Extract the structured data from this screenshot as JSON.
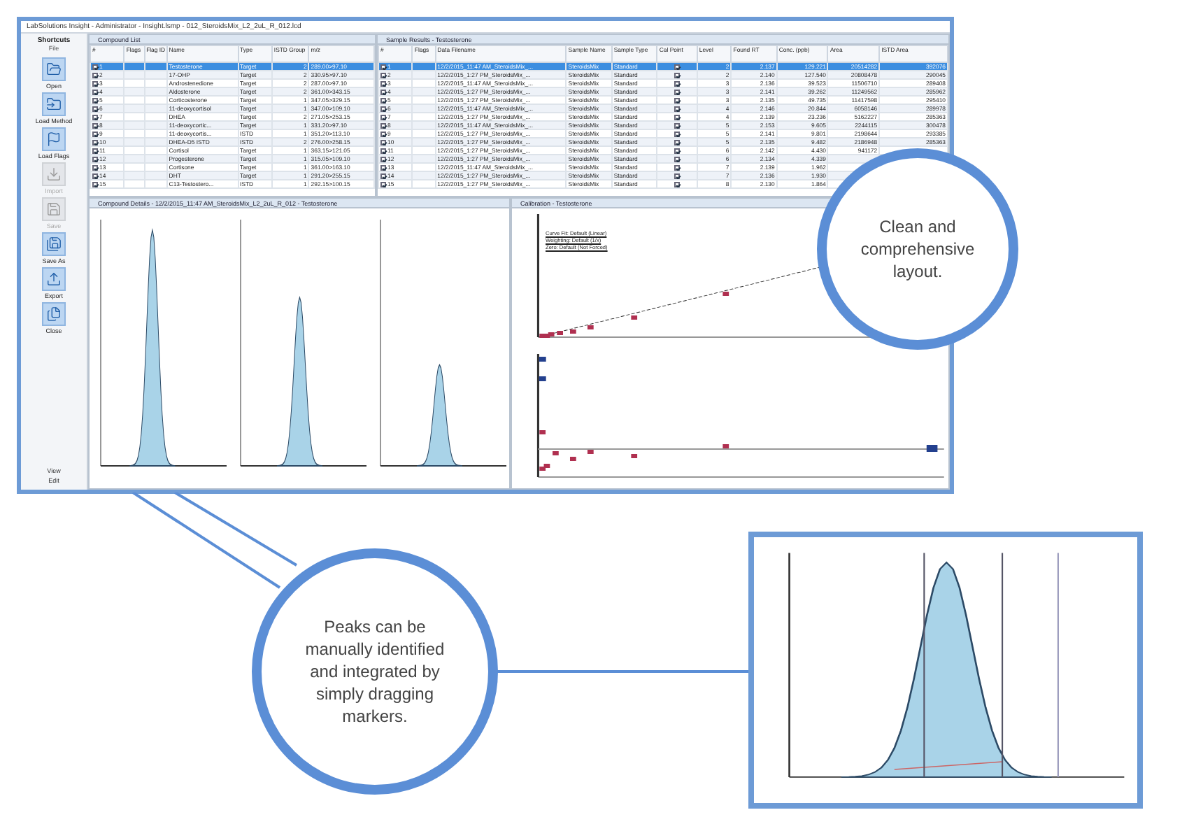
{
  "window": {
    "title": "LabSolutions Insight - Administrator - Insight.lsmp - 012_SteroidsMix_L2_2uL_R_012.lcd"
  },
  "sidebar": {
    "title": "Shortcuts",
    "section": "File",
    "items": [
      {
        "label": "Open",
        "kind": "open",
        "disabled": false
      },
      {
        "label": "Load Method",
        "kind": "method",
        "disabled": false
      },
      {
        "label": "Load Flags",
        "kind": "flags",
        "disabled": false
      },
      {
        "label": "Import",
        "kind": "import",
        "disabled": true
      },
      {
        "label": "Save",
        "kind": "save",
        "disabled": true
      },
      {
        "label": "Save As",
        "kind": "saveas",
        "disabled": false
      },
      {
        "label": "Export",
        "kind": "export",
        "disabled": false
      },
      {
        "label": "Close",
        "kind": "close",
        "disabled": false
      }
    ],
    "footer": [
      "View",
      "Edit"
    ]
  },
  "compound_list": {
    "title": "Compound List",
    "columns": [
      "#",
      "Flags",
      "Flag ID",
      "Name",
      "Type",
      "ISTD Group",
      "m/z"
    ],
    "rows": [
      {
        "n": "1",
        "name": "Testosterone",
        "type": "Target",
        "istd": "2",
        "mz": "289.00>97.10",
        "checked": true,
        "selected": true
      },
      {
        "n": "2",
        "name": "17-OHP",
        "type": "Target",
        "istd": "2",
        "mz": "330.95>97.10",
        "checked": true,
        "selected": false
      },
      {
        "n": "3",
        "name": "Androstenedione",
        "type": "Target",
        "istd": "2",
        "mz": "287.00>97.10",
        "checked": true,
        "selected": false
      },
      {
        "n": "4",
        "name": "Aldosterone",
        "type": "Target",
        "istd": "2",
        "mz": "361.00>343.15",
        "checked": true,
        "selected": false
      },
      {
        "n": "5",
        "name": "Corticosterone",
        "type": "Target",
        "istd": "1",
        "mz": "347.05>329.15",
        "checked": true,
        "selected": false
      },
      {
        "n": "6",
        "name": "11-deoxycortisol",
        "type": "Target",
        "istd": "1",
        "mz": "347.00>109.10",
        "checked": true,
        "selected": false
      },
      {
        "n": "7",
        "name": "DHEA",
        "type": "Target",
        "istd": "2",
        "mz": "271.05>253.15",
        "checked": true,
        "selected": false
      },
      {
        "n": "8",
        "name": "11-deoxycortic...",
        "type": "Target",
        "istd": "1",
        "mz": "331.20>97.10",
        "checked": true,
        "selected": false
      },
      {
        "n": "9",
        "name": "11-deoxycortis...",
        "type": "ISTD",
        "istd": "1",
        "mz": "351.20>113.10",
        "checked": true,
        "selected": false
      },
      {
        "n": "10",
        "name": "DHEA-D5 ISTD",
        "type": "ISTD",
        "istd": "2",
        "mz": "276.00>258.15",
        "checked": true,
        "selected": false
      },
      {
        "n": "11",
        "name": "Cortisol",
        "type": "Target",
        "istd": "1",
        "mz": "363.15>121.05",
        "checked": true,
        "selected": false
      },
      {
        "n": "12",
        "name": "Progesterone",
        "type": "Target",
        "istd": "1",
        "mz": "315.05>109.10",
        "checked": true,
        "selected": false
      },
      {
        "n": "13",
        "name": "Cortisone",
        "type": "Target",
        "istd": "1",
        "mz": "361.00>163.10",
        "checked": true,
        "selected": false
      },
      {
        "n": "14",
        "name": "DHT",
        "type": "Target",
        "istd": "1",
        "mz": "291.20>255.15",
        "checked": true,
        "selected": false
      },
      {
        "n": "15",
        "name": "C13-Testostero...",
        "type": "ISTD",
        "istd": "1",
        "mz": "292.15>100.15",
        "checked": true,
        "selected": false
      }
    ]
  },
  "sample_results": {
    "title": "Sample Results - Testosterone",
    "columns": [
      "#",
      "Flags",
      "Data Filename",
      "Sample Name",
      "Sample Type",
      "Cal Point",
      "Level",
      "Found RT",
      "Conc. (ppb)",
      "Area",
      "ISTD Area"
    ],
    "rows": [
      {
        "n": "1",
        "file": "12/2/2015_11:47 AM_SteroidsMix_...",
        "name": "SteroidsMix",
        "type": "Standard",
        "level": "2",
        "rt": "2.137",
        "conc": "129.221",
        "area": "20514282",
        "istd": "392076",
        "checked": true,
        "cal": true,
        "selected": true
      },
      {
        "n": "2",
        "file": "12/2/2015_1:27 PM_SteroidsMix_...",
        "name": "SteroidsMix",
        "type": "Standard",
        "level": "2",
        "rt": "2.140",
        "conc": "127.540",
        "area": "20808478",
        "istd": "290045",
        "checked": true,
        "cal": true,
        "selected": false
      },
      {
        "n": "3",
        "file": "12/2/2015_11:47 AM_SteroidsMix_...",
        "name": "SteroidsMix",
        "type": "Standard",
        "level": "3",
        "rt": "2.136",
        "conc": "39.523",
        "area": "11506710",
        "istd": "289408",
        "checked": true,
        "cal": true,
        "selected": false
      },
      {
        "n": "4",
        "file": "12/2/2015_1:27 PM_SteroidsMix_...",
        "name": "SteroidsMix",
        "type": "Standard",
        "level": "3",
        "rt": "2.141",
        "conc": "39.262",
        "area": "11249562",
        "istd": "285962",
        "checked": true,
        "cal": true,
        "selected": false
      },
      {
        "n": "5",
        "file": "12/2/2015_1:27 PM_SteroidsMix_...",
        "name": "SteroidsMix",
        "type": "Standard",
        "level": "3",
        "rt": "2.135",
        "conc": "49.735",
        "area": "11417598",
        "istd": "295410",
        "checked": true,
        "cal": true,
        "selected": false
      },
      {
        "n": "6",
        "file": "12/2/2015_11:47 AM_SteroidsMix_...",
        "name": "SteroidsMix",
        "type": "Standard",
        "level": "4",
        "rt": "2.146",
        "conc": "20.844",
        "area": "6058146",
        "istd": "289978",
        "checked": true,
        "cal": true,
        "selected": false
      },
      {
        "n": "7",
        "file": "12/2/2015_1:27 PM_SteroidsMix_...",
        "name": "SteroidsMix",
        "type": "Standard",
        "level": "4",
        "rt": "2.139",
        "conc": "23.236",
        "area": "5162227",
        "istd": "285363",
        "checked": true,
        "cal": true,
        "selected": false
      },
      {
        "n": "8",
        "file": "12/2/2015_11:47 AM_SteroidsMix_...",
        "name": "SteroidsMix",
        "type": "Standard",
        "level": "5",
        "rt": "2.153",
        "conc": "9.605",
        "area": "2244115",
        "istd": "300478",
        "checked": true,
        "cal": true,
        "selected": false
      },
      {
        "n": "9",
        "file": "12/2/2015_1:27 PM_SteroidsMix_...",
        "name": "SteroidsMix",
        "type": "Standard",
        "level": "5",
        "rt": "2.141",
        "conc": "9.801",
        "area": "2198644",
        "istd": "293385",
        "checked": true,
        "cal": true,
        "selected": false
      },
      {
        "n": "10",
        "file": "12/2/2015_1:27 PM_SteroidsMix_...",
        "name": "SteroidsMix",
        "type": "Standard",
        "level": "5",
        "rt": "2.135",
        "conc": "9.482",
        "area": "2186948",
        "istd": "285363",
        "checked": true,
        "cal": true,
        "selected": false
      },
      {
        "n": "11",
        "file": "12/2/2015_1:27 PM_SteroidsMix_...",
        "name": "SteroidsMix",
        "type": "Standard",
        "level": "6",
        "rt": "2.142",
        "conc": "4.430",
        "area": "941172",
        "checked": true,
        "cal": true,
        "selected": false
      },
      {
        "n": "12",
        "file": "12/2/2015_1:27 PM_SteroidsMix_...",
        "name": "SteroidsMix",
        "type": "Standard",
        "level": "6",
        "rt": "2.134",
        "conc": "4.339",
        "checked": true,
        "cal": true,
        "selected": false
      },
      {
        "n": "13",
        "file": "12/2/2015_11:47 AM_SteroidsMix_...",
        "name": "SteroidsMix",
        "type": "Standard",
        "level": "7",
        "rt": "2.139",
        "conc": "1.962",
        "checked": true,
        "cal": true,
        "selected": false
      },
      {
        "n": "14",
        "file": "12/2/2015_1:27 PM_SteroidsMix_...",
        "name": "SteroidsMix",
        "type": "Standard",
        "level": "7",
        "rt": "2.136",
        "conc": "1.930",
        "checked": true,
        "cal": true,
        "selected": false
      },
      {
        "n": "15",
        "file": "12/2/2015_1:27 PM_SteroidsMix_...",
        "name": "SteroidsMix",
        "type": "Standard",
        "level": "8",
        "rt": "2.130",
        "conc": "1.864",
        "checked": true,
        "cal": true,
        "selected": false
      }
    ]
  },
  "compound_details": {
    "title": "Compound Details - 12/2/2015_11:47 AM_SteroidsMix_L2_2uL_R_012 - Testosterone"
  },
  "calibration": {
    "title": "Calibration - Testosterone",
    "info": [
      "Curve Fit: Default (Linear)",
      "Weighting: Default (1/x)",
      "Zero: Default (Not Forced)"
    ]
  },
  "callouts": [
    {
      "text": "Clean and comprehensive layout."
    },
    {
      "text": "Peaks can be manually identified and integrated by simply dragging markers."
    }
  ]
}
